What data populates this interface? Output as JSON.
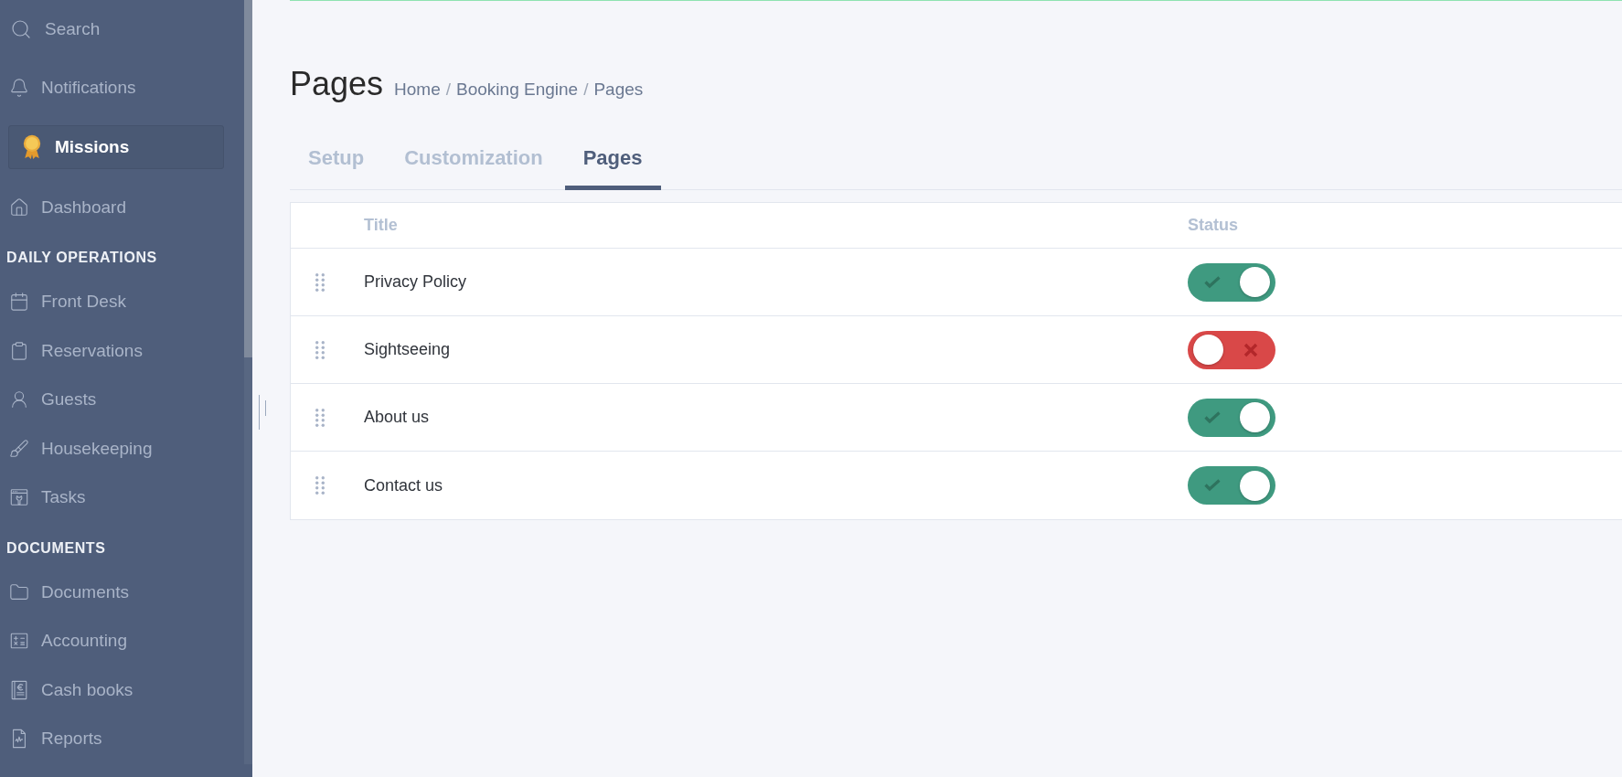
{
  "sidebar": {
    "top_items": [
      {
        "label": "Search"
      },
      {
        "label": "Notifications"
      }
    ],
    "missions": {
      "label": "Missions"
    },
    "sections": [
      {
        "items": [
          {
            "label": "Dashboard",
            "selected": false
          }
        ]
      },
      {
        "heading": "DAILY OPERATIONS",
        "items": [
          {
            "label": "Front Desk",
            "selected": false
          },
          {
            "label": "Reservations",
            "selected": false
          },
          {
            "label": "Guests",
            "selected": false
          },
          {
            "label": "Housekeeping",
            "selected": false
          },
          {
            "label": "Tasks",
            "selected": false
          }
        ]
      },
      {
        "heading": "DOCUMENTS",
        "items": [
          {
            "label": "Documents",
            "selected": false
          },
          {
            "label": "Accounting",
            "selected": false
          },
          {
            "label": "Cash books",
            "selected": false
          },
          {
            "label": "Reports",
            "selected": false
          }
        ]
      }
    ]
  },
  "page": {
    "title": "Pages",
    "breadcrumb": {
      "items": [
        "Home",
        "Booking Engine",
        "Pages"
      ],
      "separator": "/"
    }
  },
  "tabs": [
    {
      "label": "Setup",
      "selected": false
    },
    {
      "label": "Customization",
      "selected": false
    },
    {
      "label": "Pages",
      "selected": true
    }
  ],
  "table": {
    "columns": [
      "Title",
      "Status"
    ],
    "rows": [
      {
        "title": "Privacy Policy",
        "on": true
      },
      {
        "title": "Sightseeing",
        "on": false
      },
      {
        "title": "About us",
        "on": true
      },
      {
        "title": "Contact us",
        "on": true
      }
    ]
  }
}
